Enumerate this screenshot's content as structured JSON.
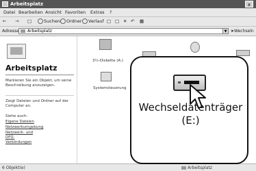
{
  "window": {
    "title": "Arbeitsplatz",
    "close_label": "x"
  },
  "menubar": {
    "items": [
      "Datei",
      "Bearbeiten",
      "Ansicht",
      "Favoriten",
      "Extras",
      "?"
    ]
  },
  "toolbar": {
    "search_label": "Suchen",
    "folders_label": "Ordner",
    "history_label": "Verlauf"
  },
  "address": {
    "label": "Adresse",
    "value": "Arbeitsplatz",
    "go_label": "Wechseln"
  },
  "left_pane": {
    "title": "Arbeitsplatz",
    "hint": "Markieren Sie ein Objekt, um seine Beschreibung anzuzeigen.",
    "show_contents": "Zeigt Dateien und Ordner auf der Computer an.",
    "see_also_label": "Siehe auch:",
    "links": [
      "Eigene Dateien",
      "Netzwerkumgebung",
      "Netzwerk- und DFÜ-Verbindungen"
    ]
  },
  "icons": {
    "floppy": "3½-Diskette (A:)",
    "control_panel": "Systemsteuerung"
  },
  "callout": {
    "drive_label_line1": "Wechseldatenträger",
    "drive_label_line2": "(E:)"
  },
  "statusbar": {
    "left": "6 Objekt(e)",
    "right": "Arbeitsplatz"
  }
}
